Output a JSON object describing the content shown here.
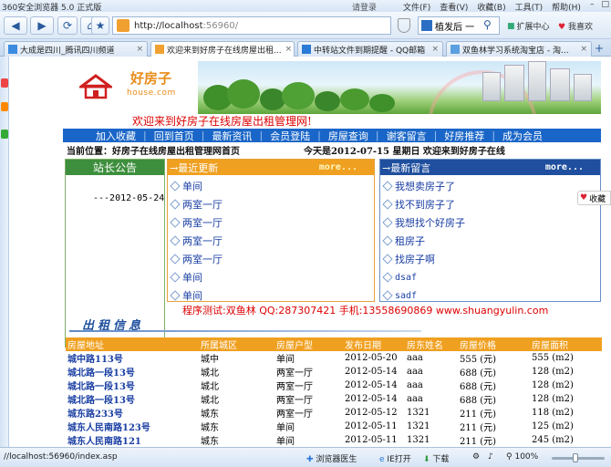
{
  "browser": {
    "app_title": "360安全浏览器 5.0 正式版",
    "login": "请登录",
    "menus": [
      "文件(F)",
      "查看(V)",
      "收藏(B)",
      "工具(T)",
      "帮助(H)"
    ],
    "url_host": "http://localhost",
    "url_port": ":56960/",
    "search_text": "植发后 一",
    "extensions_label": "扩展中心",
    "favorite_label": "我喜欢",
    "tabs": [
      {
        "label": "大成是四川_腾讯四川频道",
        "active": false
      },
      {
        "label": "欢迎来到好房子在线房屋出租...",
        "active": true
      },
      {
        "label": "中转站文件到期提醒 - QQ邮箱",
        "active": false
      },
      {
        "label": "双鱼林学习系统淘宝店 - 淘...",
        "active": false
      }
    ]
  },
  "site": {
    "logo_cn": "好房子",
    "logo_en": "house.com",
    "welcome": "欢迎来到好房子在线房屋出租管理网!",
    "nav": [
      "加入收藏",
      "回到首页",
      "最新资讯",
      "会员登陆",
      "房屋查询",
      "谢客留言",
      "好房推荐",
      "成为会员"
    ],
    "position": "当前位置：好房子在线房屋出租管理网首页",
    "date_info": "今天是2012-07-15   星期日  欢迎来到好房子在线",
    "notice": {
      "title": "站长公告",
      "date": "---2012-05-24"
    },
    "updates": {
      "title": "→最近更新",
      "more": "more...",
      "items": [
        "单间",
        "两室一厅",
        "两室一厅",
        "两室一厅",
        "两室一厅",
        "单间",
        "单间"
      ]
    },
    "messages": {
      "title": "→最新留言",
      "more": "more...",
      "items": [
        "我想卖房子了",
        "找不到房子了",
        "我想找个好房子",
        "租房子",
        "找房子啊",
        "dsaf",
        "sadf"
      ]
    },
    "contact": "程序测试:双鱼林 QQ:287307421 手机:13558690869 www.shuangyulin.com",
    "section_title": "出租信息",
    "table": {
      "headers": [
        "房屋地址",
        "所属城区",
        "房屋户型",
        "发布日期",
        "房东姓名",
        "房屋价格",
        "房屋面积"
      ],
      "rows": [
        [
          "城中路113号",
          "城中",
          "单间",
          "2012-05-20",
          "aaa",
          "555 (元)",
          "555 (m2)"
        ],
        [
          "城北路一段13号",
          "城北",
          "两室一厅",
          "2012-05-14",
          "aaa",
          "688 (元)",
          "128 (m2)"
        ],
        [
          "城北路一段13号",
          "城北",
          "两室一厅",
          "2012-05-14",
          "aaa",
          "688 (元)",
          "128 (m2)"
        ],
        [
          "城北路一段13号",
          "城北",
          "两室一厅",
          "2012-05-14",
          "aaa",
          "688 (元)",
          "128 (m2)"
        ],
        [
          "城东路233号",
          "城东",
          "两室一厅",
          "2012-05-12",
          "1321",
          "211 (元)",
          "118 (m2)"
        ],
        [
          "城东人民南路123号",
          "城东",
          "单间",
          "2012-05-11",
          "1321",
          "211 (元)",
          "125 (m2)"
        ],
        [
          "城东人民南路121",
          "城东",
          "单间",
          "2012-05-11",
          "1321",
          "211 (元)",
          "245 (m2)"
        ]
      ]
    }
  },
  "floating_fav": "收藏",
  "status": {
    "url": "//localhost:56960/index.asp",
    "doctor": "浏览器医生",
    "ie_open": "IE打开",
    "download": "下载",
    "zoom": "100%"
  }
}
